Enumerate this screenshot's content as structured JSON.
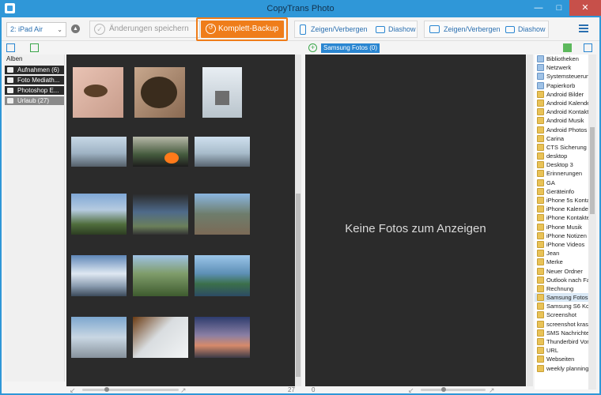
{
  "window": {
    "title": "CopyTrans Photo"
  },
  "toolbar": {
    "device": "2: iPad Air",
    "save_label": "Änderungen speichern",
    "backup_label": "Komplett-Backup",
    "left_group": {
      "show_hide": "Zeigen/Verbergen",
      "slideshow": "Diashow"
    },
    "right_group": {
      "show_hide": "Zeigen/Verbergen",
      "slideshow": "Diashow"
    }
  },
  "albums": {
    "header": "Alben",
    "items": [
      {
        "label": "Aufnahmen (6)"
      },
      {
        "label": "Foto Mediath..."
      },
      {
        "label": "Photoshop E..."
      },
      {
        "label": "Urlaub (27)"
      }
    ]
  },
  "left_status": {
    "count": "27"
  },
  "right_pane": {
    "album_tab": "Samsung Fotos (0)",
    "empty_message": "Keine Fotos zum Anzeigen",
    "count": "0"
  },
  "folders": [
    "Bibliotheken",
    "Netzwerk",
    "Systemsteuerun",
    "Papierkorb",
    "Android Bilder",
    "Android Kalende",
    "Android Kontakt",
    "Android Musik",
    "Android Photos",
    "Carina",
    "CTS Sicherung",
    "desktop",
    "Desktop 3",
    "Erinnerungen",
    "GA",
    "Geräteinfo",
    "iPhone 5s Konta",
    "iPhone Kalender",
    "iPhone Kontakte",
    "iPhone Musik",
    "iPhone Notizen",
    "iPhone Videos",
    "Jean",
    "Merke",
    "Neuer Ordner",
    "Outlook nach Fa",
    "Rechnung",
    "Samsung Fotos",
    "Samsung S6 Kor",
    "Screenshot",
    "screenshot kras",
    "SMS Nachrichten",
    "Thunderbird Vor",
    "URL",
    "Webseiten",
    "weekly planning"
  ],
  "colors": {
    "accent": "#ef7d1a",
    "titlebar": "#2f97d8",
    "pane_bg": "#2b2b2b"
  }
}
